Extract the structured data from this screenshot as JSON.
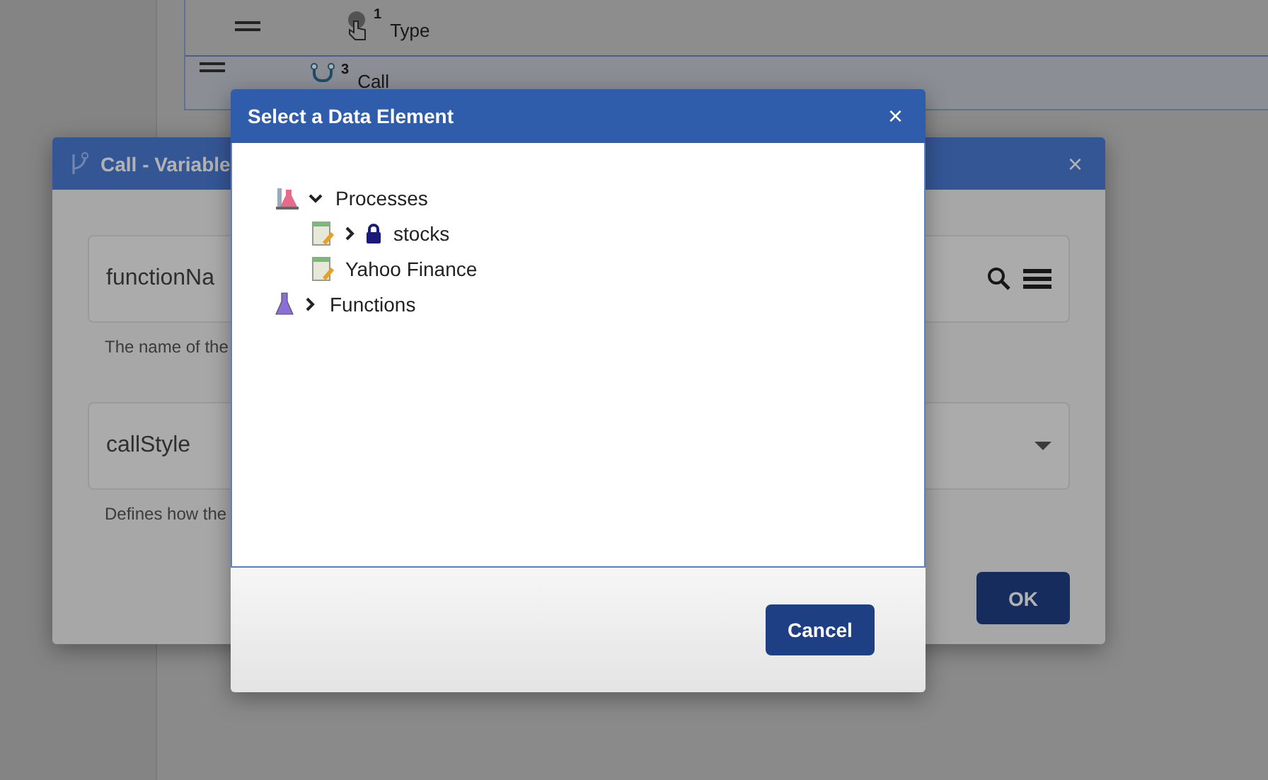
{
  "background_list": {
    "rows": [
      {
        "kind": "type",
        "badge": "1",
        "label": "Type",
        "selected": false
      },
      {
        "kind": "call",
        "badge": "3",
        "label": "Call",
        "selected": true
      }
    ]
  },
  "back_dialog": {
    "title": "Call - Variable",
    "fields": [
      {
        "kind": "lookup",
        "value": "functionNa",
        "help": "The name of the"
      },
      {
        "kind": "select",
        "value": "callStyle",
        "help": "Defines how the"
      }
    ],
    "buttons": [
      "OK"
    ]
  },
  "dialog": {
    "title": "Select a Data Element",
    "close": "×",
    "tree": [
      {
        "kind": "category",
        "label": "Processes",
        "expanded": true,
        "children": [
          {
            "kind": "item",
            "label": "stocks",
            "expandable": true,
            "expanded": false,
            "locked": true
          },
          {
            "kind": "item",
            "label": "Yahoo Finance",
            "expandable": false,
            "locked": false
          }
        ]
      },
      {
        "kind": "category",
        "label": "Functions",
        "expanded": false
      }
    ],
    "buttons": [
      "Cancel"
    ]
  },
  "back_close": "×"
}
